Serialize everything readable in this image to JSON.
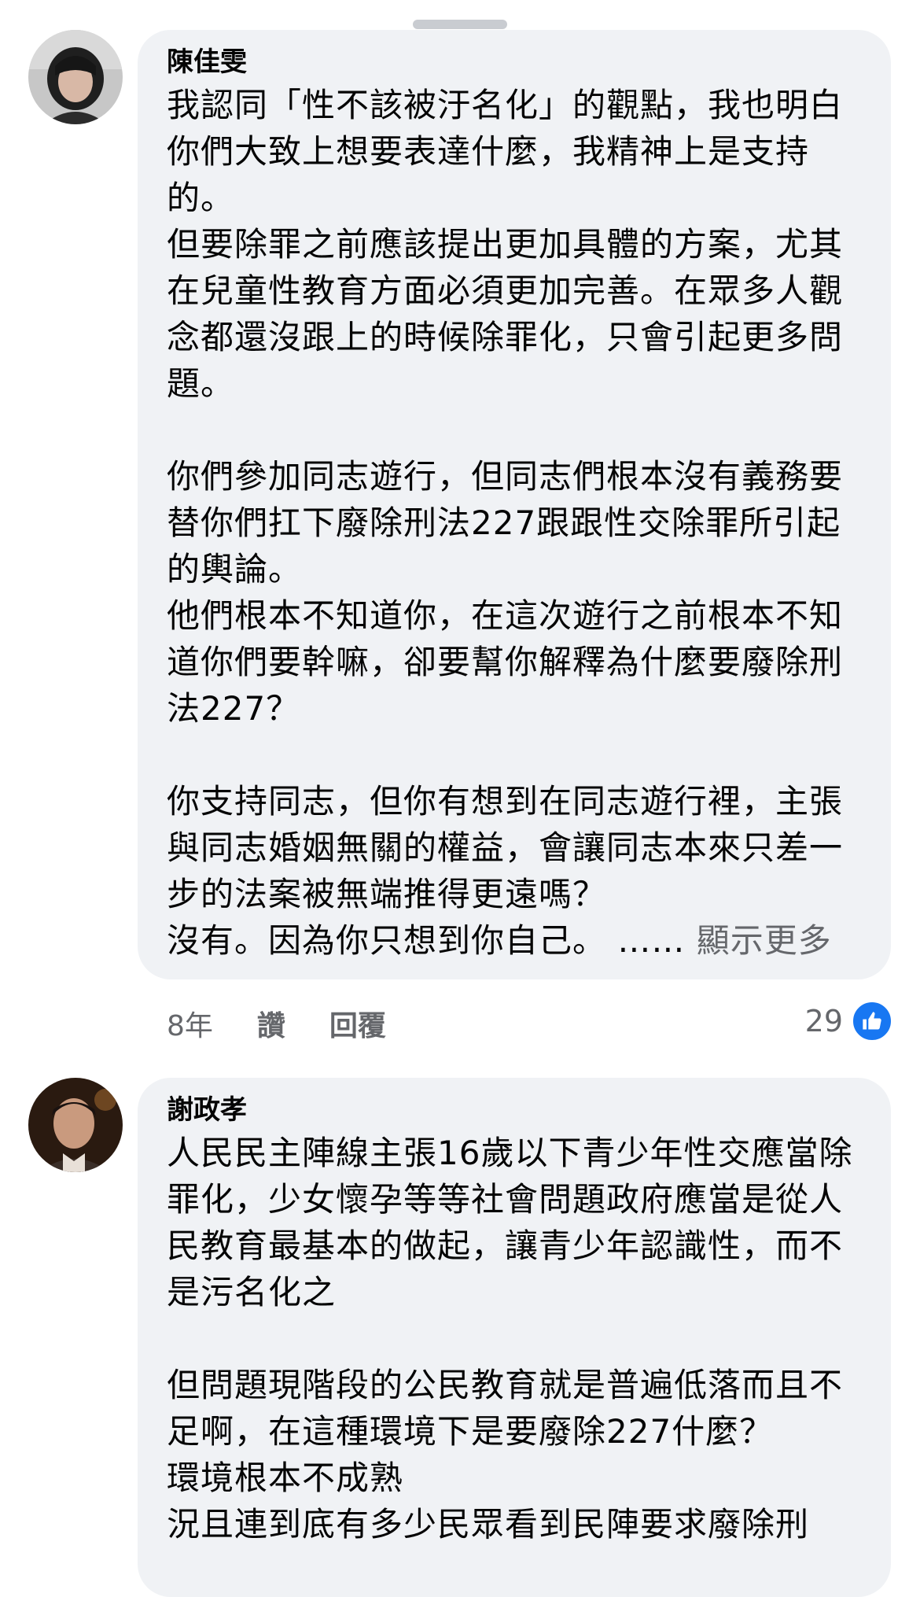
{
  "comments": [
    {
      "author": "陳佳雯",
      "text": "我認同「性不該被汙名化」的觀點，我也明白你們大致上想要表達什麼，我精神上是支持的。\n但要除罪之前應該提出更加具體的方案，尤其在兒童性教育方面必須更加完善。在眾多人觀念都還沒跟上的時候除罪化，只會引起更多問題。\n\n你們參加同志遊行，但同志們根本沒有義務要替你們扛下廢除刑法227跟跟性交除罪所引起的輿論。\n他們根本不知道你，在這次遊行之前根本不知道你們要幹嘛，卻要幫你解釋為什麼要廢除刑法227？\n\n你支持同志，但你有想到在同志遊行裡，主張與同志婚姻無關的權益，會讓同志本來只差一步的法案被無端推得更遠嗎？\n沒有。因為你只想到你自己。",
      "ellipsis": "……",
      "see_more": "顯示更多",
      "time": "8年",
      "like_label": "讚",
      "reply_label": "回覆",
      "reaction_count": "29",
      "reaction_icon": "thumbs-up-icon"
    },
    {
      "author": "謝政孝",
      "text": "人民民主陣線主張16歲以下青少年性交應當除罪化，少女懷孕等等社會問題政府應當是從人民教育最基本的做起，讓青少年認識性，而不是污名化之\n\n但問題現階段的公民教育就是普遍低落而且不足啊，在這種環境下是要廢除227什麼？\n環境根本不成熟\n況且連到底有多少民眾看到民陣要求廢除刑"
    }
  ],
  "colors": {
    "bubble": "#f0f2f5",
    "secondary_text": "#65676b",
    "like_blue": "#1877f2"
  }
}
